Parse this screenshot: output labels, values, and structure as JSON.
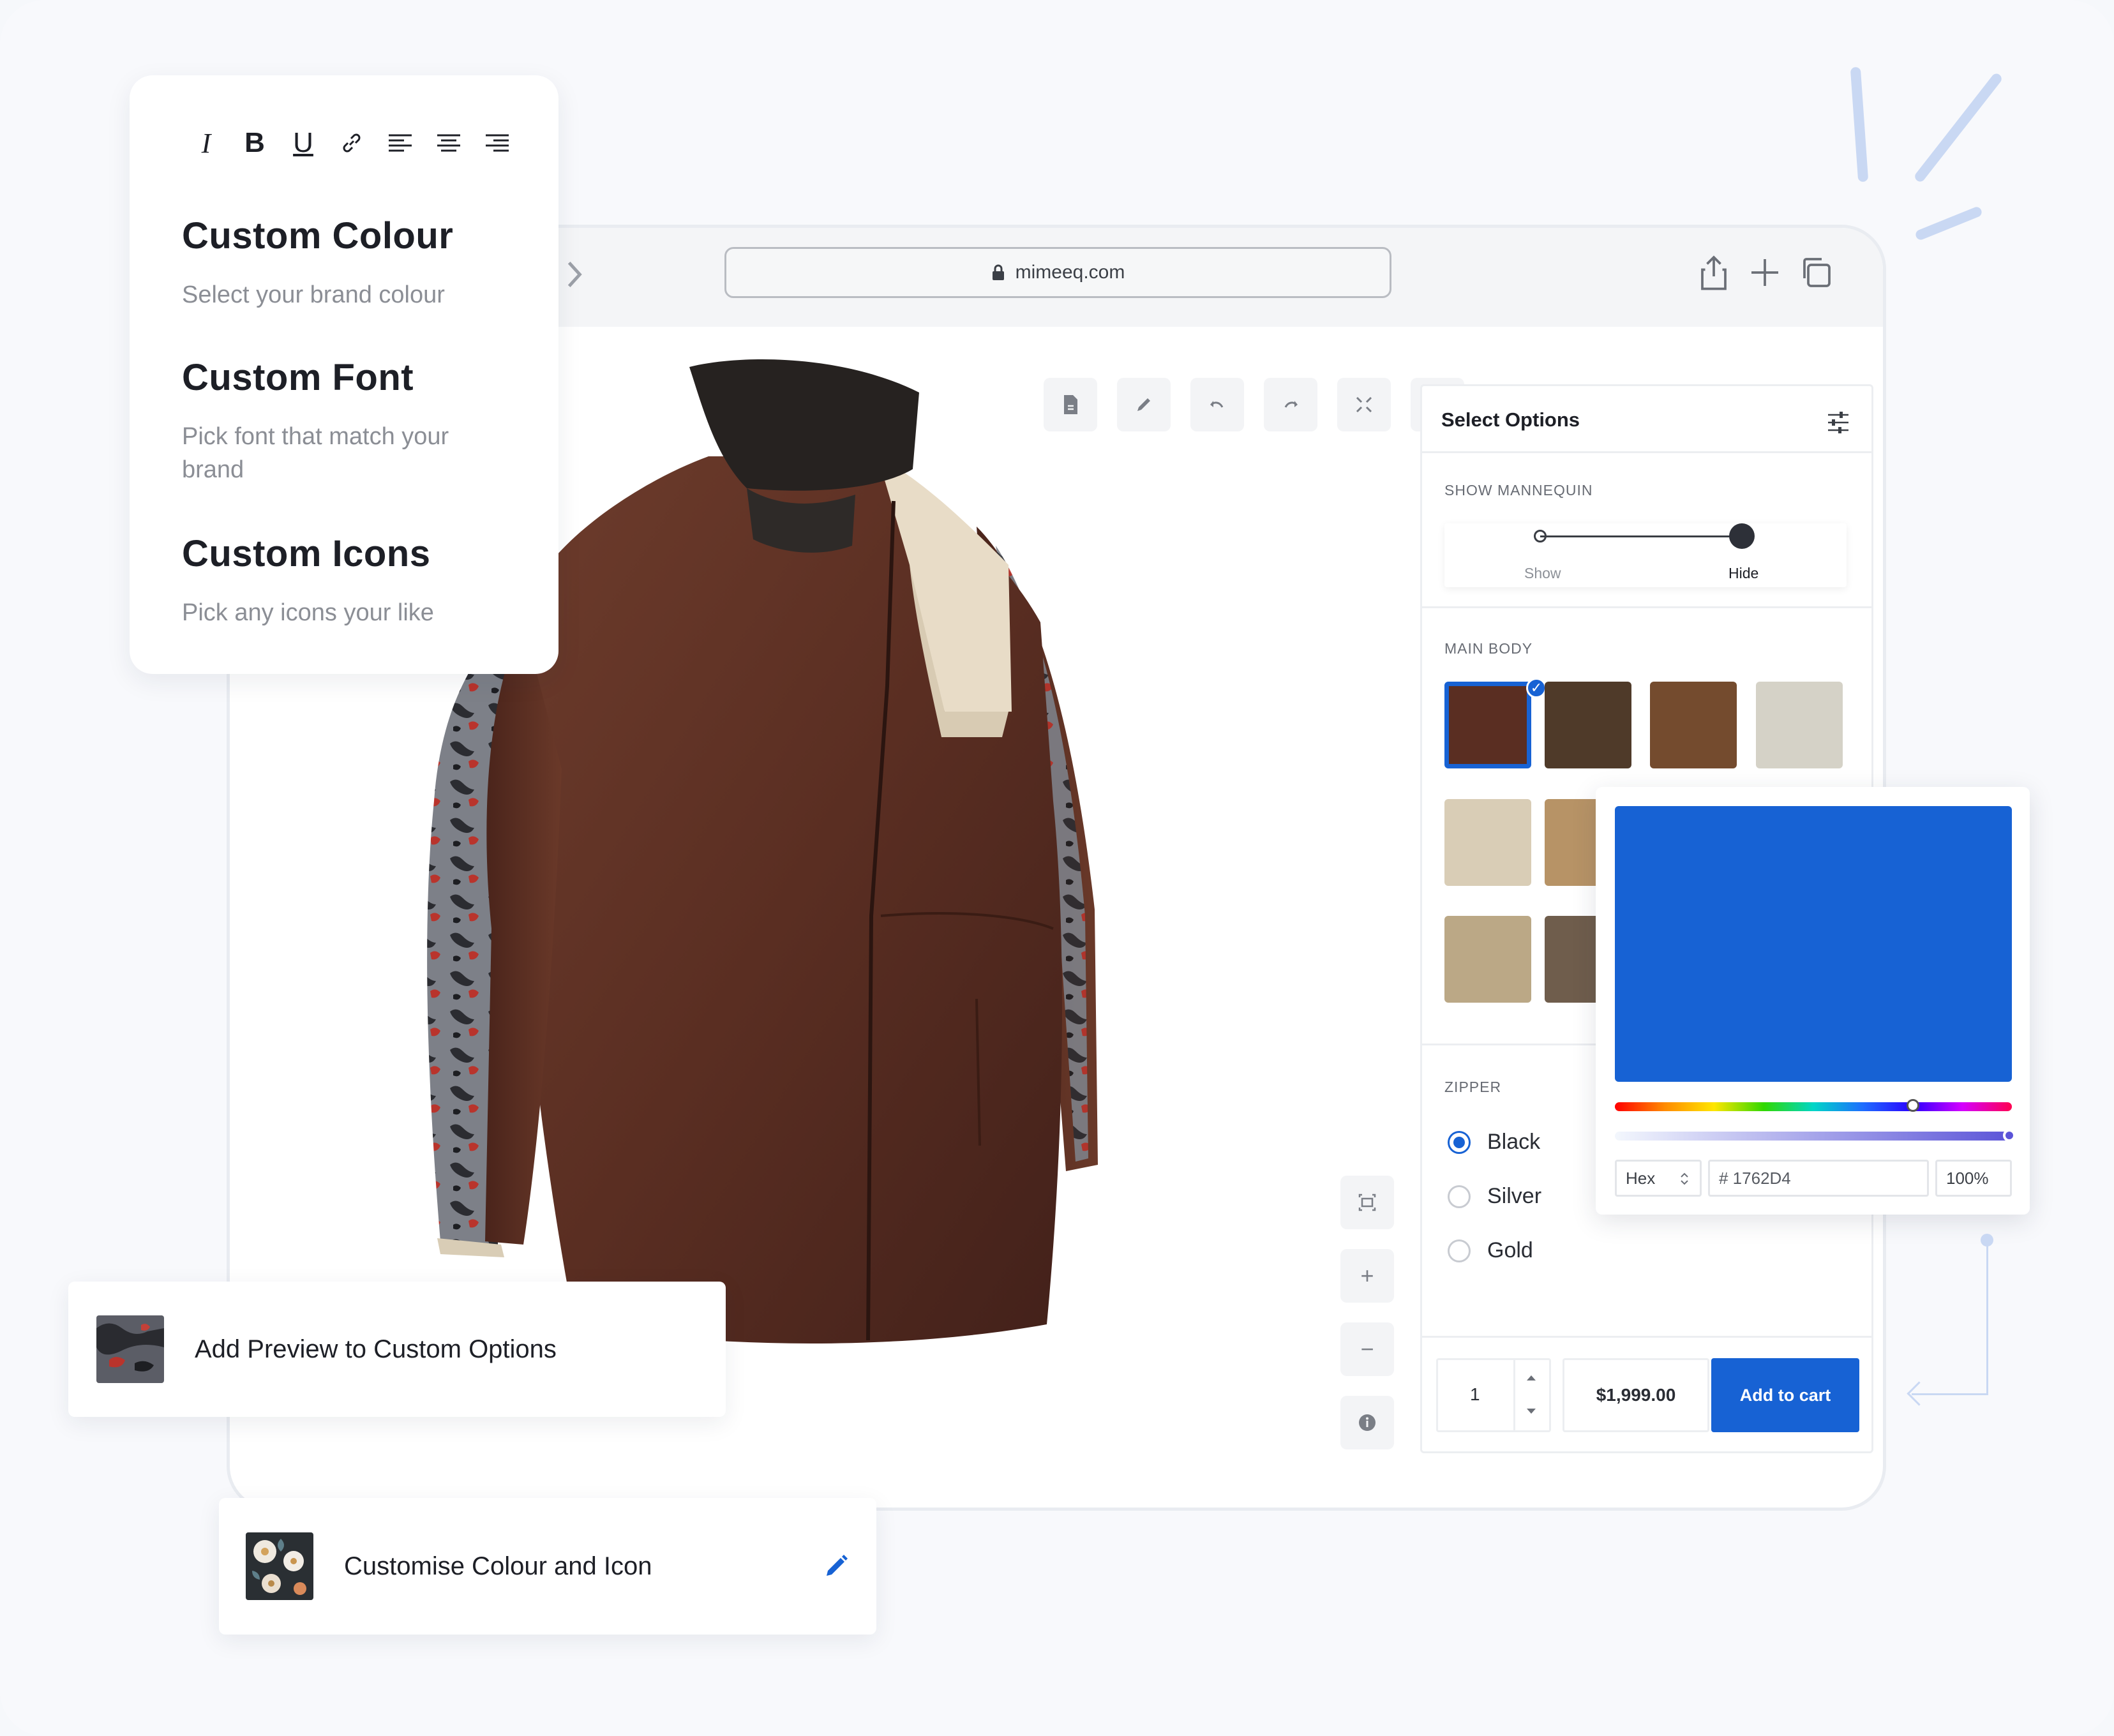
{
  "browser": {
    "url": "mimeeq.com",
    "icons": [
      "share-icon",
      "plus-icon",
      "copy-tabs-icon"
    ]
  },
  "toolbar": {
    "icons": [
      "document-icon",
      "pencil-icon",
      "undo-icon",
      "redo-icon",
      "fullscreen-icon",
      "heart-icon"
    ]
  },
  "canvas_controls": {
    "icons": [
      "frame-icon",
      "zoom-in-icon",
      "zoom-out-icon",
      "info-icon"
    ],
    "zoom_in_label": "+",
    "zoom_out_label": "−"
  },
  "panel": {
    "title": "Select Options",
    "mannequin": {
      "label": "SHOW MANNEQUIN",
      "options": [
        "Show",
        "Hide"
      ],
      "selected": "Hide"
    },
    "main_body": {
      "label": "MAIN BODY",
      "swatches": [
        "#5a2e22",
        "#4f3a29",
        "#744b2e",
        "#d5d2c7",
        "#d9cdb6",
        "#b79366",
        "#bba886",
        "#6f5d4c"
      ],
      "selected_index": 0
    },
    "zipper": {
      "label": "ZIPPER",
      "options": [
        "Black",
        "Silver",
        "Gold"
      ],
      "selected": "Black"
    },
    "quantity": "1",
    "price": "$1,999.00",
    "add_to_cart": "Add to cart"
  },
  "color_picker": {
    "color": "#1762d4",
    "format": "Hex",
    "hex_value": "# 1762D4",
    "opacity": "100%",
    "hue_position": 0.75,
    "alpha_position": 1.0
  },
  "text_card": {
    "format_icons": [
      "italic-icon",
      "bold-icon",
      "underline-icon",
      "link-icon",
      "align-left-icon",
      "align-center-icon",
      "align-right-icon"
    ],
    "format_glyphs": [
      "I",
      "B",
      "U",
      "",
      "",
      "",
      ""
    ],
    "items": [
      {
        "heading": "Custom Colour",
        "desc": "Select your brand colour"
      },
      {
        "heading": "Custom Font",
        "desc": "Pick font that match your brand"
      },
      {
        "heading": "Custom Icons",
        "desc": "Pick any icons your like"
      }
    ]
  },
  "cards": {
    "preview": "Add Preview to Custom Options",
    "customise": "Customise Colour and Icon"
  },
  "colors": {
    "accent": "#1762d4",
    "jacket_leather": "#5a2e22",
    "jacket_collar": "#262220",
    "jacket_panel": "#e8dcc7"
  }
}
